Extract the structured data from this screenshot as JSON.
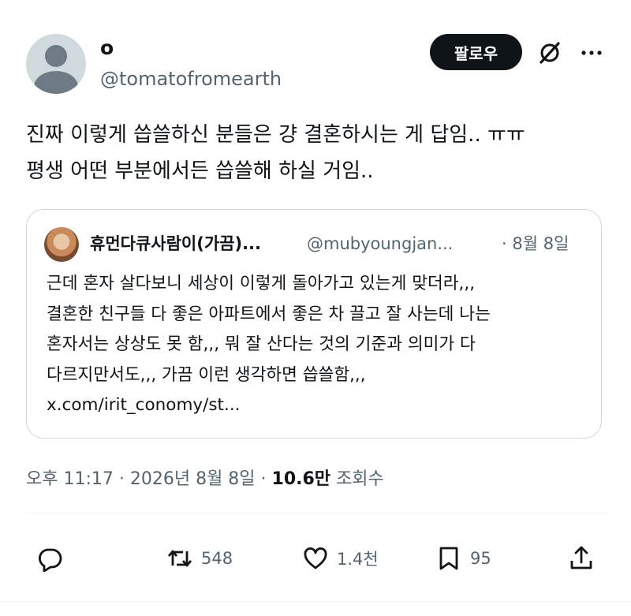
{
  "author": {
    "display_name": "o",
    "handle": "@tomatofromearth"
  },
  "header": {
    "follow_label": "팔로우"
  },
  "tweet": {
    "text_line1": "진짜 이렇게 씁쓸하신 분들은 걍 결혼하시는 게 답임.. ㅠㅠ",
    "text_line2": "평생 어떤 부분에서든 씁쓸해 하실 거임.."
  },
  "quote": {
    "display_name": "휴먼다큐사람이(가끔)...",
    "handle": "@mubyoungjan...",
    "date": "· 8월 8일",
    "lines": [
      "근데 혼자 살다보니 세상이 이렇게 돌아가고 있는게 맞더라,,,",
      "결혼한 친구들 다 좋은 아파트에서 좋은 차 끌고 잘 사는데 나는",
      "혼자서는 상상도 못 함,,, 뭐 잘 산다는 것의 기준과 의미가 다",
      "다르지만서도,,, 가끔 이런 생각하면 씁쓸함,,,",
      "x.com/irit_conomy/st..."
    ]
  },
  "meta": {
    "time_date": "오후 11:17 · 2026년 8월 8일 ·",
    "views_count": "10.6만",
    "views_label": "조회수"
  },
  "actions": {
    "reply_count": "",
    "retweet_count": "548",
    "like_count": "1.4천",
    "bookmark_count": "95"
  },
  "icons": [
    "person-placeholder-icon",
    "grok-icon",
    "more-icon",
    "reply-icon",
    "retweet-icon",
    "like-icon",
    "bookmark-icon",
    "share-icon"
  ],
  "colors": {
    "text_primary": "#0f1419",
    "text_secondary": "#536471",
    "border": "#cfd9de",
    "follow_bg": "#0f1419"
  }
}
